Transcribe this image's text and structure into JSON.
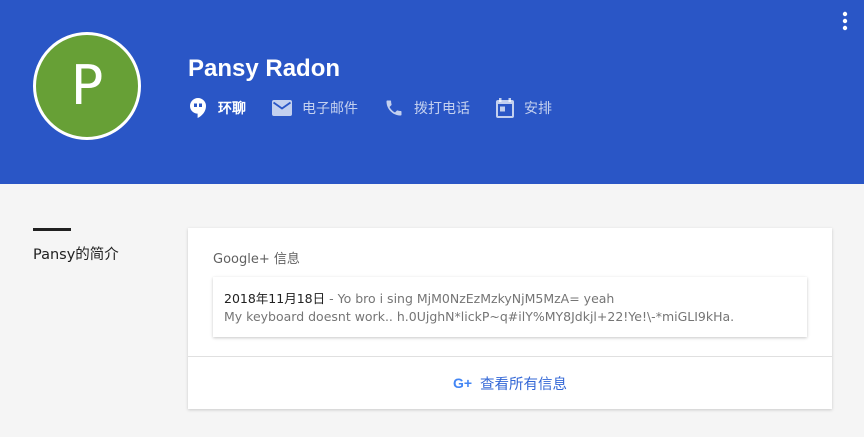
{
  "profile": {
    "initial": "P",
    "avatar_color": "#67a036",
    "name": "Pansy Radon"
  },
  "header": {
    "background": "#2a56c6"
  },
  "actions": [
    {
      "icon": "hangouts-icon",
      "label": "环聊",
      "active": true
    },
    {
      "icon": "email-icon",
      "label": "电子邮件"
    },
    {
      "icon": "phone-icon",
      "label": "拨打电话"
    },
    {
      "icon": "calendar-icon",
      "label": "安排"
    }
  ],
  "section": {
    "title": "Pansy的简介"
  },
  "card": {
    "title": "Google+ 信息",
    "post": {
      "date": "2018年11月18日",
      "separator": " - ",
      "line1_text": "Yo bro i sing MjM0NzEzMzkyNjM5MzA= yeah",
      "line2_text": "My keyboard doesnt work.. h.0UjghN*lickP~q#ilY%MY8Jdkjl+22!Ye!\\-*miGLI9kHa."
    },
    "view_all_icon": "G+",
    "view_all_label": "查看所有信息"
  }
}
